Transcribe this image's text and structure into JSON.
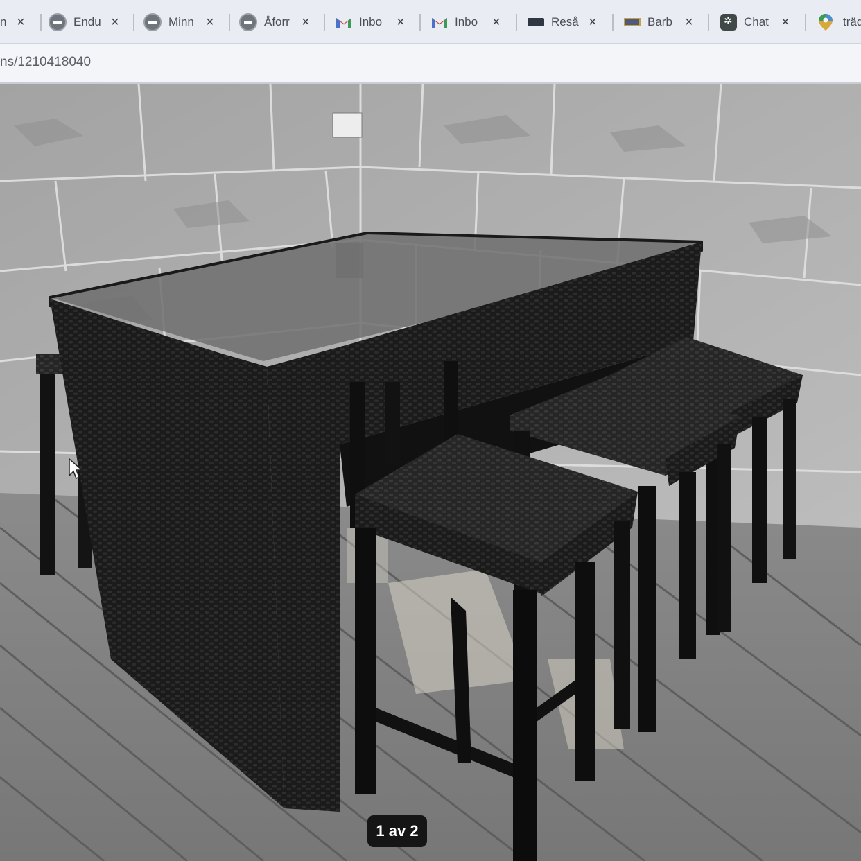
{
  "browser": {
    "tabs": [
      {
        "label": "n",
        "icon": "partial-tab"
      },
      {
        "label": "Endu",
        "icon": "ork-logo-icon"
      },
      {
        "label": "Minn",
        "icon": "ork-logo-icon"
      },
      {
        "label": "Åforr",
        "icon": "ork-logo-icon"
      },
      {
        "label": "Inbo",
        "icon": "gmail-icon"
      },
      {
        "label": "Inbo",
        "icon": "gmail-icon"
      },
      {
        "label": "Reså",
        "icon": "jysk-icon"
      },
      {
        "label": "Barb",
        "icon": "ikea-icon"
      },
      {
        "label": "Chat",
        "icon": "chat-icon"
      },
      {
        "label": "träd",
        "icon": "maps-pin-icon"
      }
    ],
    "close_glyph": "×",
    "url": "ns/1210418040"
  },
  "gallery": {
    "counter": "1 av 2"
  }
}
